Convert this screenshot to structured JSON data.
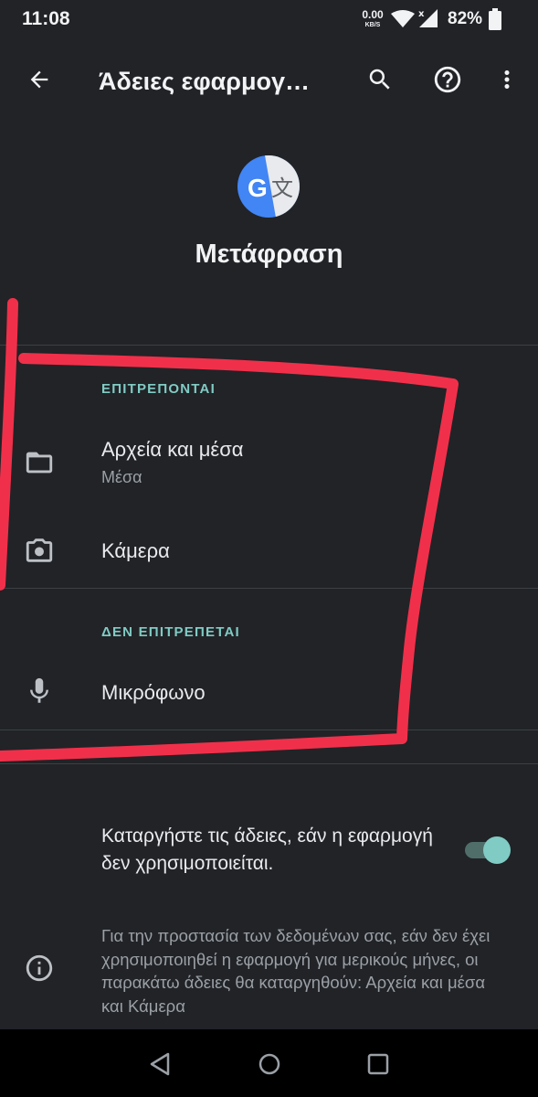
{
  "status_bar": {
    "time": "11:08",
    "net_speed": "0.00",
    "net_unit": "KB/S",
    "battery": "82%"
  },
  "app_bar": {
    "title": "Άδειες εφαρμογ…",
    "back_icon": "arrow-back-icon",
    "search_icon": "search-icon",
    "help_icon": "help-circle-icon",
    "more_icon": "more-vert-icon"
  },
  "app": {
    "name": "Μετάφραση",
    "logo_letter": "G",
    "logo_glyph": "文"
  },
  "allowed": {
    "header": "ΕΠΙΤΡΕΠΟΝΤΑΙ",
    "items": [
      {
        "icon": "folder-icon",
        "title": "Αρχεία και μέσα",
        "subtitle": "Μέσα"
      },
      {
        "icon": "camera-icon",
        "title": "Κάμερα"
      }
    ]
  },
  "denied": {
    "header": "ΔΕΝ ΕΠΙΤΡΕΠΕΤΑΙ",
    "items": [
      {
        "icon": "microphone-icon",
        "title": "Μικρόφωνο"
      }
    ]
  },
  "auto_revoke": {
    "label": "Καταργήστε τις άδειες, εάν η εφαρμογή δεν χρησιμοποιείται.",
    "enabled": true
  },
  "info": {
    "icon": "info-icon",
    "text": "Για την προστασία των δεδομένων σας, εάν δεν έχει χρησιμοποιηθεί η εφαρμογή για μερικούς μήνες, οι παρακάτω άδειες θα καταργηθούν: Αρχεία και μέσα και Κάμερα"
  },
  "nav_bar": {
    "back_icon": "nav-back-icon",
    "home_icon": "nav-home-icon",
    "recents_icon": "nav-recents-icon"
  },
  "colors": {
    "background": "#212327",
    "accent": "#80cbc4",
    "annotation": "#f0304a"
  }
}
